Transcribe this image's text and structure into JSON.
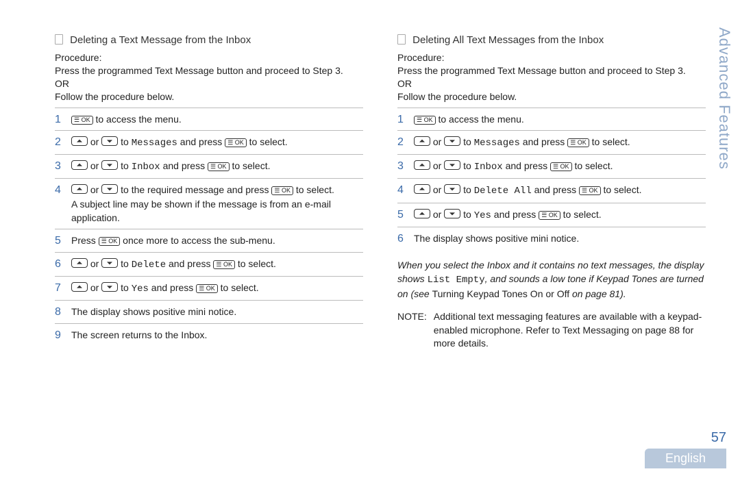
{
  "sideTab": "Advanced Features",
  "pageNumber": "57",
  "language": "English",
  "t": {
    "or": " or ",
    "toAccessMenu": " to access the menu.",
    "toMessages": " to ",
    "messages": "Messages",
    "andPress": " and press ",
    "toSelect": " to select.",
    "inbox": "Inbox",
    "deleteAll": "Delete All",
    "delete": "Delete",
    "yes": "Yes"
  },
  "left": {
    "heading": "Deleting a Text Message from the Inbox",
    "intro": "Procedure:\nPress the programmed Text Message  button and proceed to Step 3.\nOR\nFollow the procedure below.",
    "step4b": "A subject line may be shown if the message is from an e-mail application.",
    "step4a_pre": " to the required message and press ",
    "step5_pre": "Press ",
    "step5_post": " once more to access the sub-menu.",
    "step8": "The display shows positive mini notice.",
    "step9": "The screen returns to the Inbox."
  },
  "right": {
    "heading": "Deleting All Text Messages from the Inbox",
    "intro": "Procedure:\nPress the programmed Text Message  button and proceed to Step 3.\nOR\nFollow the procedure below.",
    "step6": "The display shows positive mini notice.",
    "noteItalic_pre": "When you select the Inbox and it contains no text messages, the display shows ",
    "noteItalic_mono": "List Empty",
    "noteItalic_mid": ", and sounds a low tone if Keypad Tones are turned on (see ",
    "noteItalic_link": "Turning Keypad Tones On or Off",
    "noteItalic_post": "  on page 81).",
    "note2Label": "NOTE:",
    "note2Body": "Additional text messaging features are available with a keypad-enabled microphone. Refer to Text Messaging  on page 88 for more details."
  }
}
